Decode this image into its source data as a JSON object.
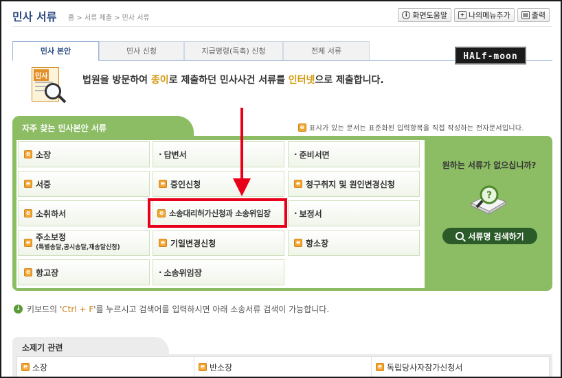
{
  "header": {
    "title": "민사 서류",
    "breadcrumb": "홈 > 서류 제출 > 민사 서류",
    "buttons": [
      {
        "label": "화면도움말",
        "icon": "info-icon"
      },
      {
        "label": "나의메뉴추가",
        "icon": "bookmark-icon"
      },
      {
        "label": "출력",
        "icon": "printer-icon"
      }
    ]
  },
  "tabs": [
    "민사 본안",
    "민사 신청",
    "지급명령(독촉) 신청",
    "전체 서류"
  ],
  "active_tab": "민사 본안",
  "logo_text": "HALf-moon",
  "doc_icon_label": "민사",
  "intro": {
    "part1": "법원을 방문하여 ",
    "hl1": "종이",
    "part2": "로 제출하던 민사사건 서류를 ",
    "hl2": "인터넷",
    "part3": "으로 제출합니다."
  },
  "frequent": {
    "title": "자주 찾는 민사본안 서류",
    "note": "표시가 있는 문서는 표준화된 입력항목을 직접 작성하는 전자문서입니다.",
    "items": [
      {
        "label": "소장",
        "e": true
      },
      {
        "label": "답변서",
        "e": false
      },
      {
        "label": "준비서면",
        "e": false
      },
      {
        "label": "서증",
        "e": true
      },
      {
        "label": "증인신청",
        "e": true
      },
      {
        "label": "청구취지 및 원인변경신청",
        "e": true
      },
      {
        "label": "소취하서",
        "e": true
      },
      {
        "label": "소송대리허가신청과 소송위임장",
        "e": true
      },
      {
        "label": "보정서",
        "e": false
      },
      {
        "label": "주소보정",
        "sub": "(특별송달,공시송달,재송달신청)",
        "e": true
      },
      {
        "label": "기일변경신청",
        "e": true
      },
      {
        "label": "항소장",
        "e": true
      },
      {
        "label": "항고장",
        "e": true
      },
      {
        "label": "소송위임장",
        "e": false
      }
    ],
    "side_question": "원하는 서류가 없으십니까?",
    "search_button": "서류명 검색하기"
  },
  "keyboard_tip": {
    "pre": "키보드의 '",
    "key": "Ctrl + F",
    "post": "'를 누르시고 검색어를 입력하시면 아래 소송서류 검색이 가능합니다."
  },
  "section2": {
    "title": "소제기 관련",
    "items": [
      "소장",
      "반소장",
      "독립당사자참가신청서"
    ]
  },
  "colors": {
    "green": "#8cbc64",
    "dark_green": "#2c5b2a",
    "title_blue": "#2c4a83",
    "highlight": "#d39a0e",
    "annotation_red": "#e8001a"
  }
}
